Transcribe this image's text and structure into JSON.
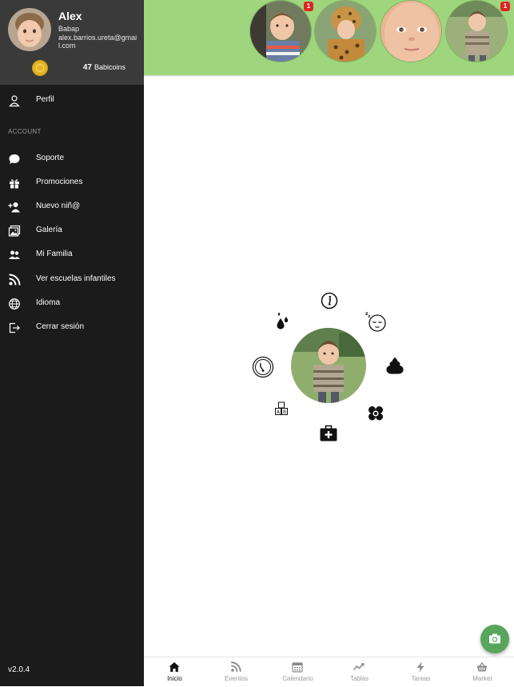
{
  "user": {
    "name": "Alex",
    "subtitle": "Babap",
    "email": "alex.barrios.ureta@gmail.com",
    "coins_count": "47",
    "coins_label": "Babicoins"
  },
  "menu": {
    "profile": "Perfil",
    "section_account": "ACCOUNT",
    "items": [
      "Soporte",
      "Promociones",
      "Nuevo niñ@",
      "Galería",
      "Mi Familia",
      "Ver escuelas infantiles",
      "Idioma",
      "Cerrar sesión"
    ]
  },
  "version": "v2.0.4",
  "children": [
    {
      "badge": "1"
    },
    {
      "badge": ""
    },
    {
      "badge": ""
    },
    {
      "badge": "1"
    }
  ],
  "tabs": [
    "Inicio",
    "Eventos",
    "Calendario",
    "Tablas",
    "Tareas",
    "Market"
  ],
  "active_tab": "Inicio",
  "icons": {
    "activities": [
      "info-icon",
      "water-drops-icon",
      "sleep-face-icon",
      "poop-icon",
      "flower-icon",
      "first-aid-kit-icon",
      "toy-blocks-icon",
      "pacifier-icon"
    ],
    "fab": "camera-icon"
  },
  "colors": {
    "banner": "#9fd67d",
    "sidebar": "#1b1b1b",
    "profile_panel": "#3a3a3a",
    "fab": "#58a55c",
    "badge": "#e02424"
  }
}
